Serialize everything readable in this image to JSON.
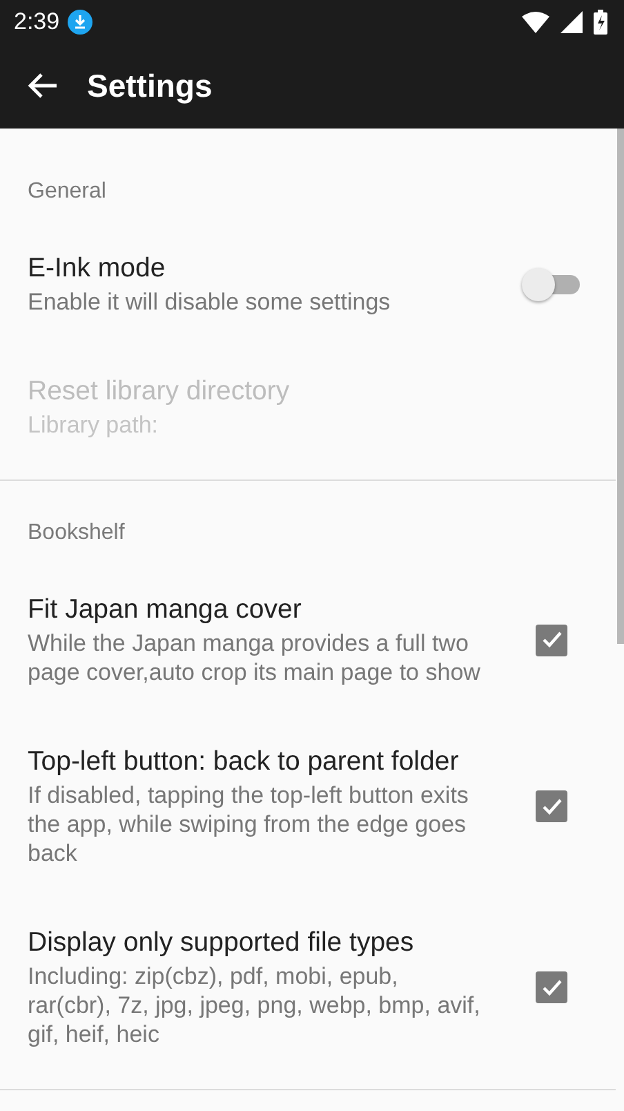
{
  "status_bar": {
    "time": "2:39"
  },
  "toolbar": {
    "title": "Settings"
  },
  "sections": [
    {
      "header": "General",
      "items": [
        {
          "kind": "switch",
          "title": "E-Ink mode",
          "summary": "Enable it will disable some settings",
          "on": false,
          "disabled": false
        },
        {
          "kind": "plain",
          "title": "Reset library directory",
          "summary": "Library path:",
          "disabled": true
        }
      ]
    },
    {
      "header": "Bookshelf",
      "items": [
        {
          "kind": "checkbox",
          "title": "Fit Japan manga cover",
          "summary": "While the Japan manga provides a full two page cover,auto crop its main page to show",
          "checked": true,
          "disabled": false
        },
        {
          "kind": "checkbox",
          "title": "Top-left button: back to parent folder",
          "summary": "If disabled, tapping the top-left button exits the app, while swiping from the edge goes back",
          "checked": true,
          "disabled": false
        },
        {
          "kind": "checkbox",
          "title": "Display only supported file types",
          "summary": "Including: zip(cbz), pdf, mobi, epub, rar(cbr), 7z, jpg, jpeg, png, webp, bmp, avif, gif, heif, heic",
          "checked": true,
          "disabled": false
        }
      ]
    }
  ]
}
